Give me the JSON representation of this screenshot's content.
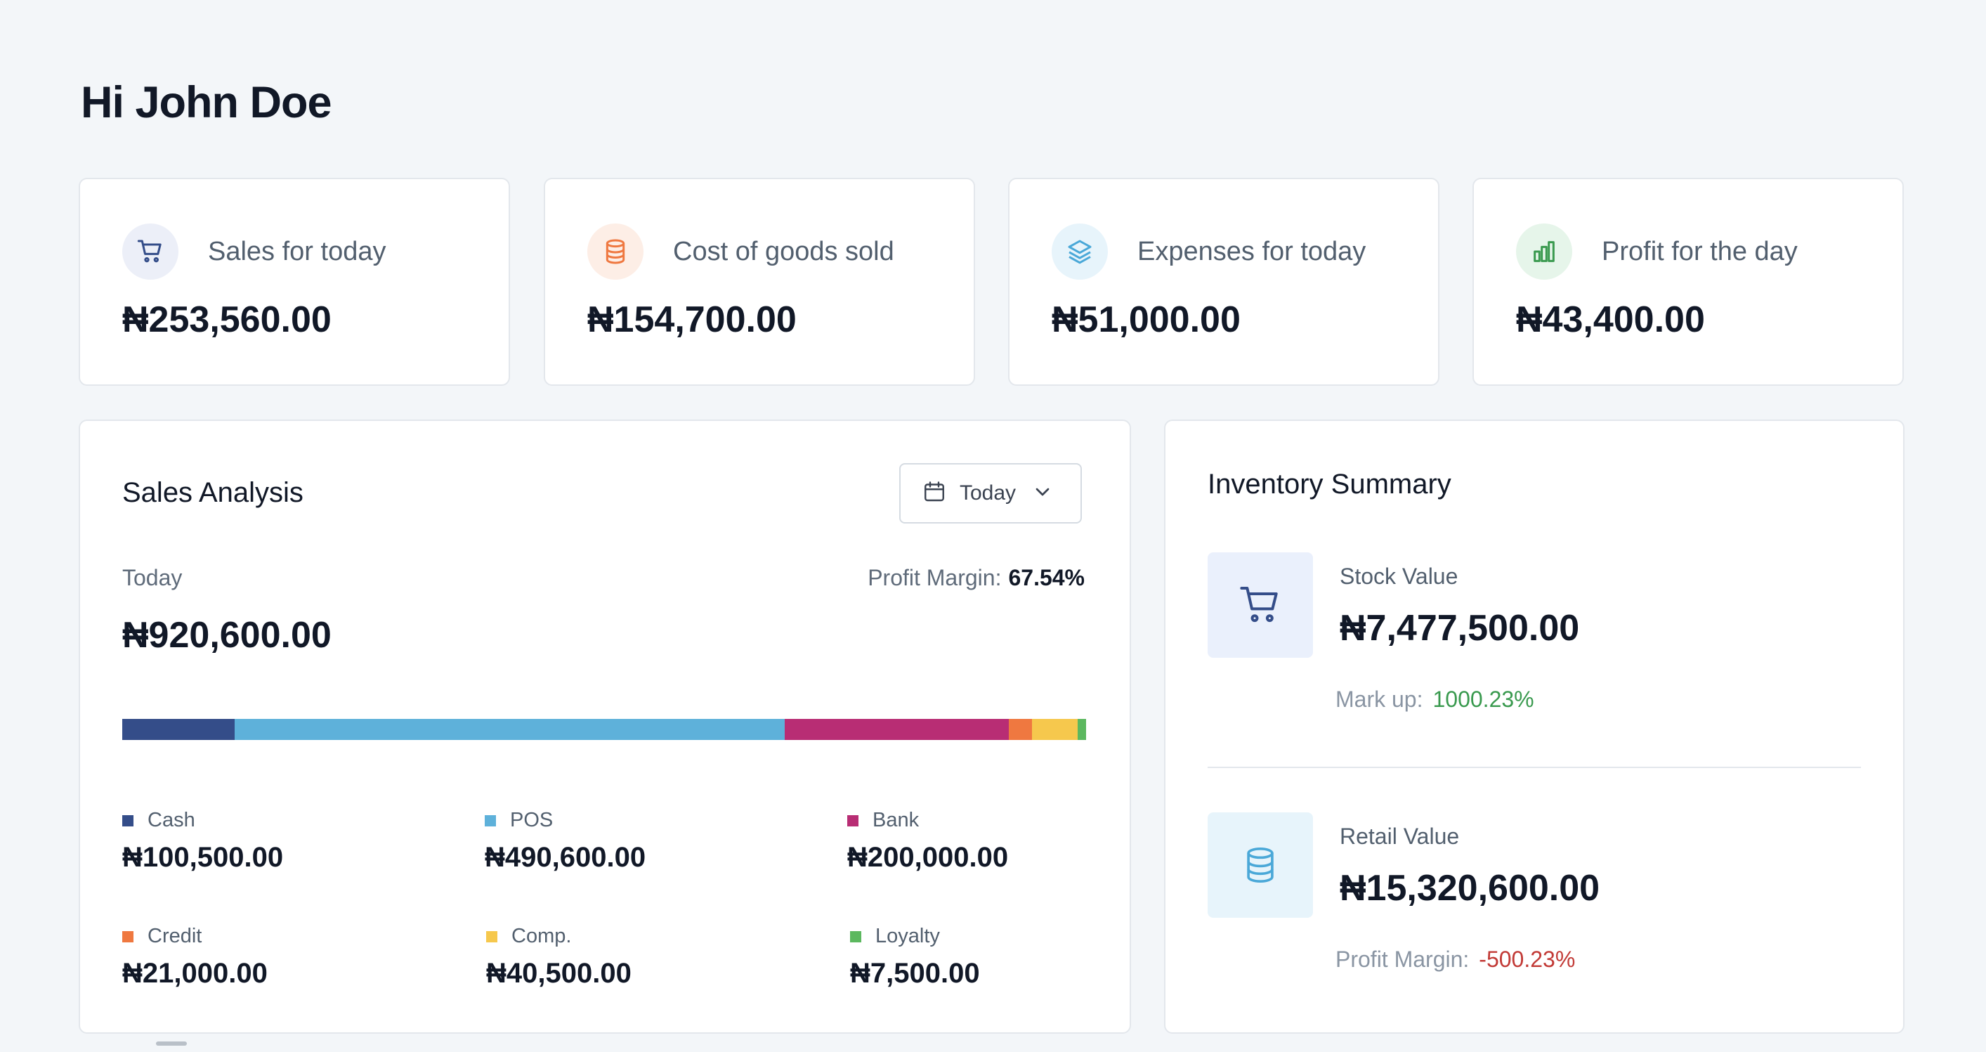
{
  "greeting": "Hi John Doe",
  "stats": [
    {
      "label": "Sales for today",
      "value": "₦253,560.00",
      "icon": "cart-icon"
    },
    {
      "label": "Cost of goods sold",
      "value": "₦154,700.00",
      "icon": "database-icon"
    },
    {
      "label": "Expenses for today",
      "value": "₦51,000.00",
      "icon": "layers-icon"
    },
    {
      "label": "Profit for the day",
      "value": "₦43,400.00",
      "icon": "bar-chart-icon"
    }
  ],
  "sales_analysis": {
    "title": "Sales Analysis",
    "filter_label": "Today",
    "period": "Today",
    "profit_margin_label": "Profit Margin:",
    "profit_margin_value": "67.54%",
    "total": "₦920,600.00",
    "legend": [
      {
        "name": "Cash",
        "value": "₦100,500.00"
      },
      {
        "name": "POS",
        "value": "₦490,600.00"
      },
      {
        "name": "Bank",
        "value": "₦200,000.00"
      },
      {
        "name": "Credit",
        "value": "₦21,000.00"
      },
      {
        "name": "Comp.",
        "value": "₦40,500.00"
      },
      {
        "name": "Loyalty",
        "value": "₦7,500.00"
      }
    ]
  },
  "chart_data": {
    "type": "bar",
    "categories": [
      "Cash",
      "POS",
      "Bank",
      "Credit",
      "Comp.",
      "Loyalty"
    ],
    "values": [
      100500,
      490600,
      200000,
      21000,
      40500,
      7500
    ],
    "colors": [
      "#344d89",
      "#5eb1da",
      "#b82d74",
      "#ef7840",
      "#f6c84d",
      "#5cb85f"
    ]
  },
  "inventory": {
    "title": "Inventory Summary",
    "stock_label": "Stock Value",
    "stock_value": "₦7,477,500.00",
    "markup_label": "Mark up:",
    "markup_value": "1000.23%",
    "retail_label": "Retail Value",
    "retail_value": "₦15,320,600.00",
    "profit_margin_label": "Profit Margin:",
    "profit_margin_value": "-500.23%"
  },
  "colors": {
    "positive": "#3a9a4f",
    "negative": "#c23a36"
  }
}
